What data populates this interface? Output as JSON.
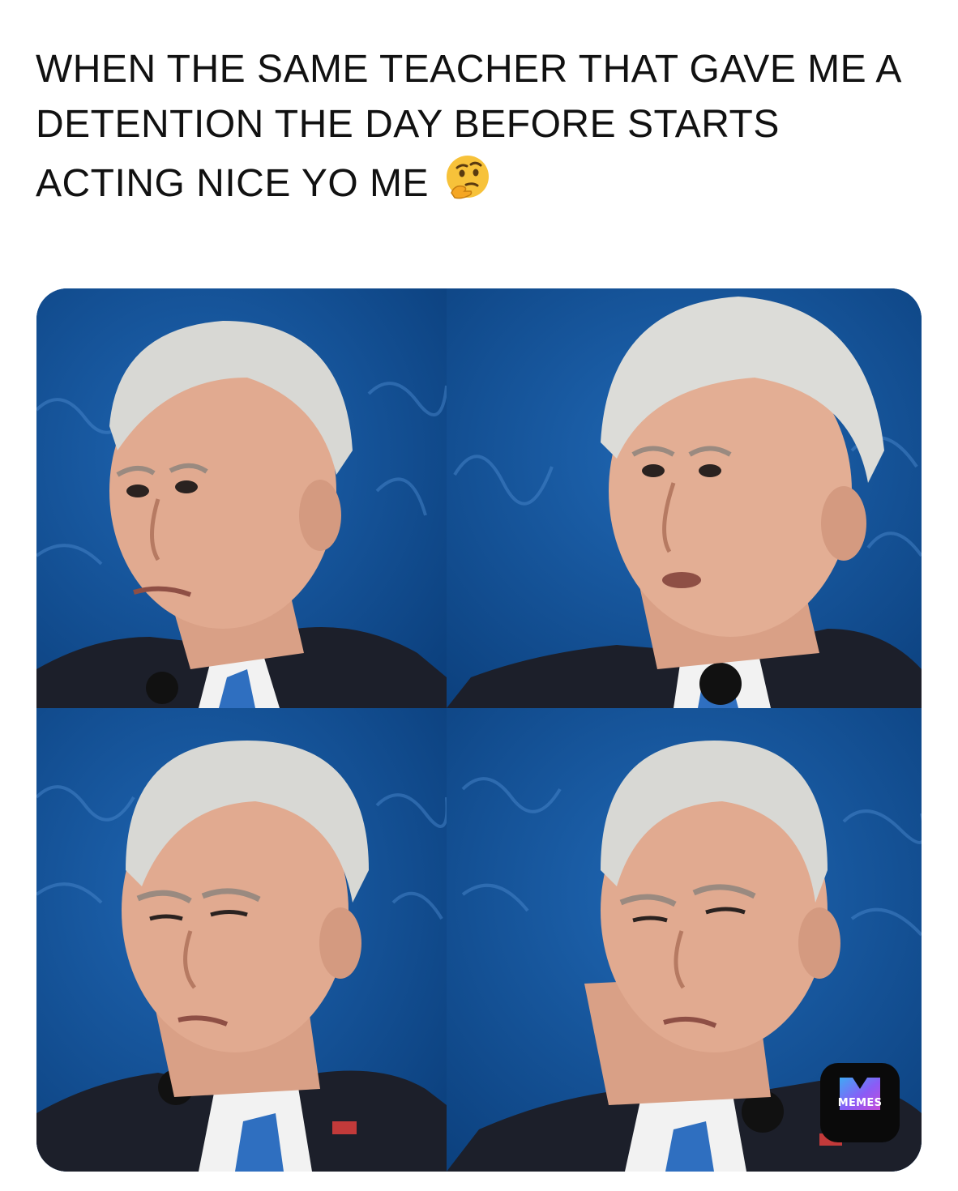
{
  "caption": {
    "text": "WHEN THE SAME TEACHER THAT GAVE ME A DETENTION THE DAY BEFORE STARTS ACTING NICE YO ME",
    "emoji": "🤔",
    "emoji_icon": "thinking-face-icon"
  },
  "photo_grid": {
    "layout": "2x2",
    "panels": [
      {
        "id": "top-left",
        "expression": "looking-left-wide-eyed"
      },
      {
        "id": "top-right",
        "expression": "looking-left-surprised"
      },
      {
        "id": "bottom-left",
        "expression": "squinting"
      },
      {
        "id": "bottom-right",
        "expression": "squinting-skeptical"
      }
    ],
    "backdrop_color": "#0d4a8c"
  },
  "watermark": {
    "label": "MEMES",
    "icon": "memes-logo-icon"
  }
}
